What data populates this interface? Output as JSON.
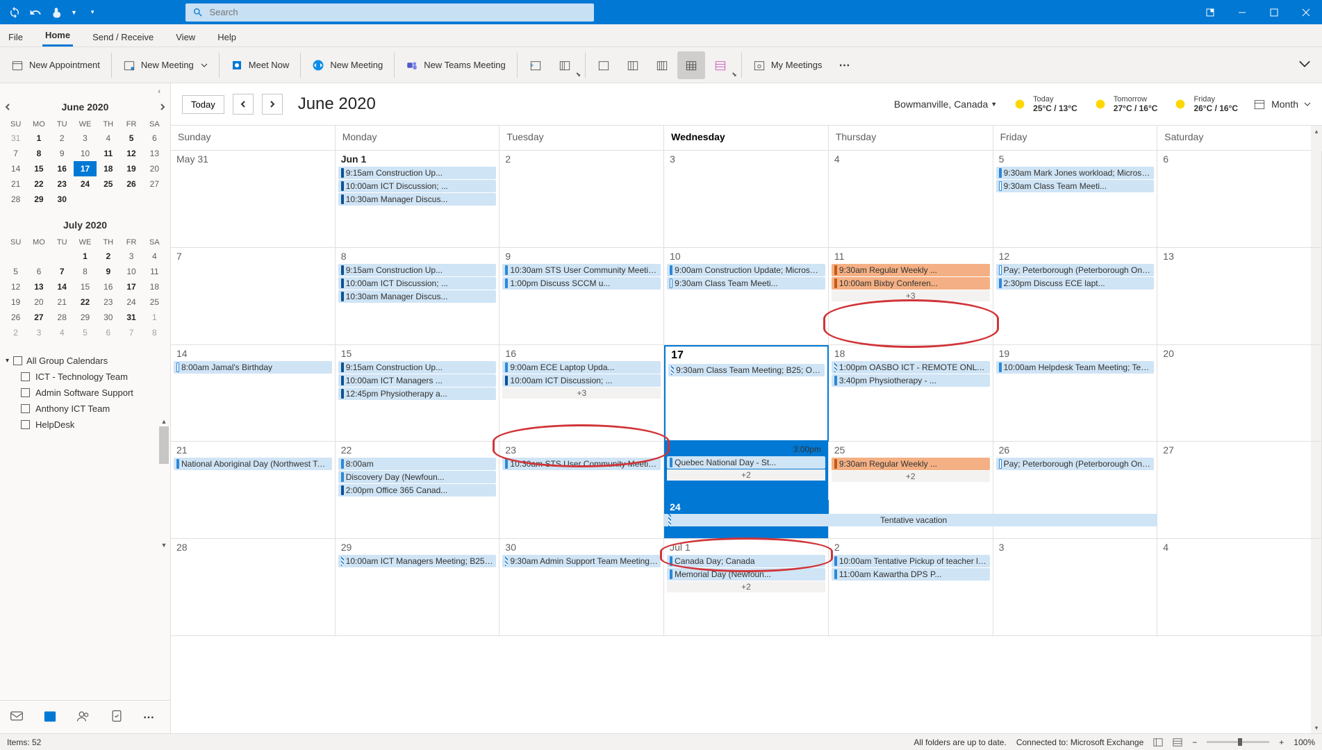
{
  "titlebar": {
    "search_placeholder": "Search"
  },
  "tabs": {
    "file": "File",
    "home": "Home",
    "send_receive": "Send / Receive",
    "view": "View",
    "help": "Help"
  },
  "ribbon": {
    "new_appointment": "New Appointment",
    "new_meeting": "New Meeting",
    "meet_now": "Meet Now",
    "new_meeting_tv": "New Meeting",
    "new_teams_meeting": "New Teams Meeting",
    "my_meetings": "My Meetings"
  },
  "mini_cal_1": {
    "title": "June 2020",
    "dow": [
      "SU",
      "MO",
      "TU",
      "WE",
      "TH",
      "FR",
      "SA"
    ],
    "days": [
      {
        "n": "31",
        "muted": true
      },
      {
        "n": "1",
        "bold": true
      },
      {
        "n": "2"
      },
      {
        "n": "3"
      },
      {
        "n": "4"
      },
      {
        "n": "5",
        "bold": true
      },
      {
        "n": "6"
      },
      {
        "n": "7"
      },
      {
        "n": "8",
        "bold": true
      },
      {
        "n": "9"
      },
      {
        "n": "10"
      },
      {
        "n": "11",
        "bold": true
      },
      {
        "n": "12",
        "bold": true
      },
      {
        "n": "13"
      },
      {
        "n": "14"
      },
      {
        "n": "15",
        "bold": true
      },
      {
        "n": "16",
        "bold": true
      },
      {
        "n": "17",
        "today": true
      },
      {
        "n": "18",
        "bold": true
      },
      {
        "n": "19",
        "bold": true
      },
      {
        "n": "20"
      },
      {
        "n": "21"
      },
      {
        "n": "22",
        "bold": true
      },
      {
        "n": "23",
        "bold": true
      },
      {
        "n": "24",
        "bold": true
      },
      {
        "n": "25",
        "bold": true
      },
      {
        "n": "26",
        "bold": true
      },
      {
        "n": "27"
      },
      {
        "n": "28"
      },
      {
        "n": "29",
        "bold": true
      },
      {
        "n": "30",
        "bold": true
      }
    ]
  },
  "mini_cal_2": {
    "title": "July 2020",
    "dow": [
      "SU",
      "MO",
      "TU",
      "WE",
      "TH",
      "FR",
      "SA"
    ],
    "days": [
      {
        "n": ""
      },
      {
        "n": ""
      },
      {
        "n": ""
      },
      {
        "n": "1",
        "bold": true
      },
      {
        "n": "2",
        "bold": true
      },
      {
        "n": "3"
      },
      {
        "n": "4"
      },
      {
        "n": "5"
      },
      {
        "n": "6"
      },
      {
        "n": "7",
        "bold": true
      },
      {
        "n": "8"
      },
      {
        "n": "9",
        "bold": true
      },
      {
        "n": "10"
      },
      {
        "n": "11"
      },
      {
        "n": "12"
      },
      {
        "n": "13",
        "bold": true
      },
      {
        "n": "14",
        "bold": true
      },
      {
        "n": "15"
      },
      {
        "n": "16"
      },
      {
        "n": "17",
        "bold": true
      },
      {
        "n": "18"
      },
      {
        "n": "19"
      },
      {
        "n": "20"
      },
      {
        "n": "21"
      },
      {
        "n": "22",
        "bold": true
      },
      {
        "n": "23"
      },
      {
        "n": "24"
      },
      {
        "n": "25"
      },
      {
        "n": "26"
      },
      {
        "n": "27",
        "bold": true
      },
      {
        "n": "28"
      },
      {
        "n": "29"
      },
      {
        "n": "30"
      },
      {
        "n": "31",
        "bold": true
      },
      {
        "n": "1",
        "muted": true
      },
      {
        "n": "2",
        "muted": true
      },
      {
        "n": "3",
        "muted": true
      },
      {
        "n": "4",
        "muted": true
      },
      {
        "n": "5",
        "muted": true
      },
      {
        "n": "6",
        "muted": true
      },
      {
        "n": "7",
        "muted": true
      },
      {
        "n": "8",
        "muted": true
      }
    ]
  },
  "cal_list": {
    "head": "All Group Calendars",
    "items": [
      "ICT - Technology Team",
      "Admin Software Support",
      "Anthony ICT Team",
      "HelpDesk"
    ]
  },
  "toolbar": {
    "today": "Today",
    "title": "June 2020",
    "location": "Bowmanville, Canada",
    "wx": [
      {
        "label": "Today",
        "temp": "25°C / 13°C"
      },
      {
        "label": "Tomorrow",
        "temp": "27°C / 16°C"
      },
      {
        "label": "Friday",
        "temp": "26°C / 16°C"
      }
    ],
    "view": "Month"
  },
  "dow": [
    "Sunday",
    "Monday",
    "Tuesday",
    "Wednesday",
    "Thursday",
    "Friday",
    "Saturday"
  ],
  "weeks": [
    [
      {
        "num": "May 31"
      },
      {
        "num": "Jun 1",
        "bold": true,
        "evts": [
          {
            "t": "9:15am Construction Up...",
            "c": "blue darkbar"
          },
          {
            "t": "10:00am ICT Discussion; ...",
            "c": "blue darkbar"
          },
          {
            "t": "10:30am Manager Discus...",
            "c": "blue darkbar"
          }
        ]
      },
      {
        "num": "2"
      },
      {
        "num": "3"
      },
      {
        "num": "4"
      },
      {
        "num": "5",
        "evts": [
          {
            "t": "9:30am Mark Jones workload; Microsoft Tea...",
            "c": "blue"
          },
          {
            "t": "9:30am Class Team Meeti...",
            "c": "blue whitebar"
          }
        ]
      },
      {
        "num": "6"
      }
    ],
    [
      {
        "num": "7"
      },
      {
        "num": "8",
        "evts": [
          {
            "t": "9:15am Construction Up...",
            "c": "blue darkbar"
          },
          {
            "t": "10:00am ICT Discussion; ...",
            "c": "blue darkbar"
          },
          {
            "t": "10:30am Manager Discus...",
            "c": "blue darkbar"
          }
        ]
      },
      {
        "num": "9",
        "evts": [
          {
            "t": "10:30am STS User Community Meeting; STS...",
            "c": "blue"
          },
          {
            "t": "1:00pm Discuss SCCM u...",
            "c": "blue"
          }
        ]
      },
      {
        "num": "10",
        "evts": [
          {
            "t": "9:00am Construction Update; Microsoft Teams ...",
            "c": "blue"
          },
          {
            "t": "9:30am Class Team Meeti...",
            "c": "blue whitebar"
          }
        ]
      },
      {
        "num": "11",
        "evts": [
          {
            "t": "9:30am Regular Weekly ...",
            "c": "orange"
          },
          {
            "t": "10:00am Bixby Conferen...",
            "c": "orange"
          }
        ],
        "more": "+3"
      },
      {
        "num": "12",
        "evts": [
          {
            "t": "Pay; Peterborough (Peterborough  Ontario, ...",
            "c": "blue whitebar"
          },
          {
            "t": "2:30pm Discuss ECE lapt...",
            "c": "blue"
          }
        ]
      },
      {
        "num": "13"
      }
    ],
    [
      {
        "num": "14",
        "evts": [
          {
            "t": "8:00am Jamal's Birthday",
            "c": "blue whitebar"
          }
        ]
      },
      {
        "num": "15",
        "evts": [
          {
            "t": "9:15am Construction Up...",
            "c": "blue darkbar"
          },
          {
            "t": "10:00am ICT Managers ...",
            "c": "blue darkbar"
          },
          {
            "t": "12:45pm Physiotherapy a...",
            "c": "blue darkbar"
          }
        ]
      },
      {
        "num": "16",
        "evts": [
          {
            "t": "9:00am ECE Laptop Upda...",
            "c": "blue"
          },
          {
            "t": "10:00am ICT Discussion; ...",
            "c": "blue darkbar"
          }
        ],
        "more": "+3"
      },
      {
        "num": "17",
        "today": true,
        "evts": [
          {
            "t": "9:30am Class Team Meeting; B25; Owen McIntosh",
            "c": "blue tent"
          }
        ]
      },
      {
        "num": "18",
        "evts": [
          {
            "t": "1:00pm OASBO ICT - REMOTE ONLY; OASBO I...",
            "c": "blue tent"
          },
          {
            "t": "3:40pm Physiotherapy - ...",
            "c": "blue"
          }
        ]
      },
      {
        "num": "19",
        "evts": [
          {
            "t": "10:00am Helpdesk Team Meeting; Teams; Anthony Brice",
            "c": "blue"
          }
        ]
      },
      {
        "num": "20"
      }
    ],
    [
      {
        "num": "21",
        "evts": [
          {
            "t": "National Aboriginal Day (Northwest Territories); Canada",
            "c": "blue allday"
          }
        ]
      },
      {
        "num": "22",
        "evts": [
          {
            "t": "8:00am",
            "c": "blue"
          },
          {
            "t": "Discovery Day (Newfoun...",
            "c": "blue"
          },
          {
            "t": "2:00pm Office 365 Canad...",
            "c": "blue darkbar"
          }
        ]
      },
      {
        "num": "23",
        "evts": [
          {
            "t": "10:30am STS User Community Meeting; STS...",
            "c": "blue"
          }
        ]
      },
      {
        "num": "24",
        "todayhead": true,
        "time": "3:00pm",
        "evts": [
          {
            "t": "Quebec National Day - St...",
            "c": "blue"
          }
        ],
        "more": "+2"
      },
      {
        "num": "25",
        "evts": [
          {
            "t": "9:30am Regular Weekly ...",
            "c": "orange"
          }
        ],
        "more": "+2"
      },
      {
        "num": "26",
        "evts": [
          {
            "t": "Pay; Peterborough (Peterborough  Ontario, ...",
            "c": "blue whitebar"
          }
        ]
      },
      {
        "num": "27"
      }
    ],
    [
      {
        "num": "28"
      },
      {
        "num": "29",
        "evts": [
          {
            "t": "10:00am ICT Managers Meeting; B25; Dan Fitzgerald",
            "c": "blue tent"
          }
        ]
      },
      {
        "num": "30",
        "evts": [
          {
            "t": "9:30am Admin Support Team Meeting; B25; Owen McIntosh",
            "c": "blue tent"
          }
        ]
      },
      {
        "num": "Jul 1",
        "evts": [
          {
            "t": "Canada Day; Canada",
            "c": "blue"
          },
          {
            "t": "Memorial Day (Newfoun...",
            "c": "blue"
          }
        ],
        "more": "+2"
      },
      {
        "num": "2",
        "evts": [
          {
            "t": "10:00am Tentative Pickup of teacher laptops at 3 lo...",
            "c": "blue"
          },
          {
            "t": "11:00am Kawartha DPS P...",
            "c": "blue"
          }
        ]
      },
      {
        "num": "3"
      },
      {
        "num": "4"
      }
    ]
  ],
  "tentative_span": "Tentative vacation",
  "statusbar": {
    "items": "Items: 52",
    "folders": "All folders are up to date.",
    "connected": "Connected to: Microsoft Exchange",
    "zoom": "100%"
  }
}
